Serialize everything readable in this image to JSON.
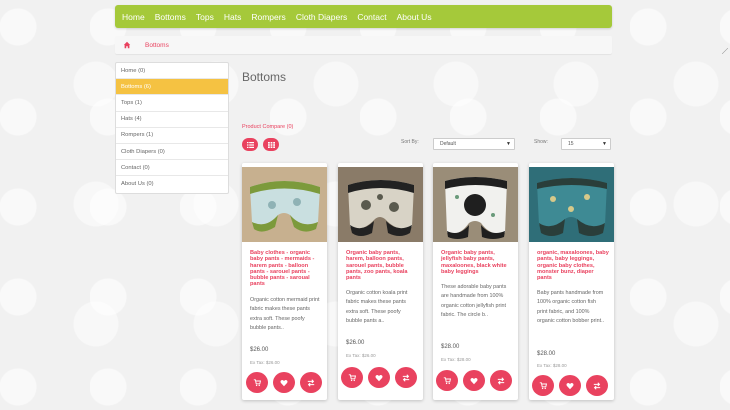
{
  "nav": [
    "Home",
    "Bottoms",
    "Tops",
    "Hats",
    "Rompers",
    "Cloth Diapers",
    "Contact",
    "About Us"
  ],
  "breadcrumb": {
    "current": "Bottoms"
  },
  "sidebar": {
    "items": [
      {
        "label": "Home (0)"
      },
      {
        "label": "Bottoms (6)"
      },
      {
        "label": "Tops (1)"
      },
      {
        "label": "Hats (4)"
      },
      {
        "label": "Rompers (1)"
      },
      {
        "label": "Cloth Diapers (0)"
      },
      {
        "label": "Contact (0)"
      },
      {
        "label": "About Us (0)"
      }
    ]
  },
  "page_title": "Bottoms",
  "product_compare": "Product Compare (0)",
  "sort": {
    "label": "Sort By:",
    "value": "Default"
  },
  "show": {
    "label": "Show:",
    "value": "15"
  },
  "products": [
    {
      "title": "Baby clothes - organic baby pants - mermaids - harem pants - balloon pants - sarouel pants - bubble pants - saroual pants",
      "description": "Organic cotton mermaid print fabric makes these pants extra soft. These poofy bubble pants..",
      "price": "$26.00",
      "tax": "Ex Tax: $26.00"
    },
    {
      "title": "Organic baby pants, harem, balloon pants, sarouel pants, bubble pants, zoo pants, koala pants",
      "description": "Organic cotton koala print fabric makes these pants extra soft. These poofy bubble pants a..",
      "price": "$26.00",
      "tax": "Ex Tax: $26.00"
    },
    {
      "title": "Organic baby pants, jellyfish baby pants, maxaloones, black white baby leggings",
      "description": "These adorable baby pants are handmade from 100% organic cotton jellyfish print fabric. The circle b..",
      "price": "$28.00",
      "tax": "Ex Tax: $28.00"
    },
    {
      "title": "organic, maxaloones, baby pants, baby leggings, organic baby clothes, monster bunz, diaper pants",
      "description": "Baby pants handmade from 100% organic cotton fish print fabric, and 100% organic cotton bobber print..",
      "price": "$28.00",
      "tax": "Ex Tax: $28.00"
    }
  ],
  "colors": {
    "nav": "#a5c93a",
    "accent": "#e9425f",
    "active": "#f5c242"
  }
}
